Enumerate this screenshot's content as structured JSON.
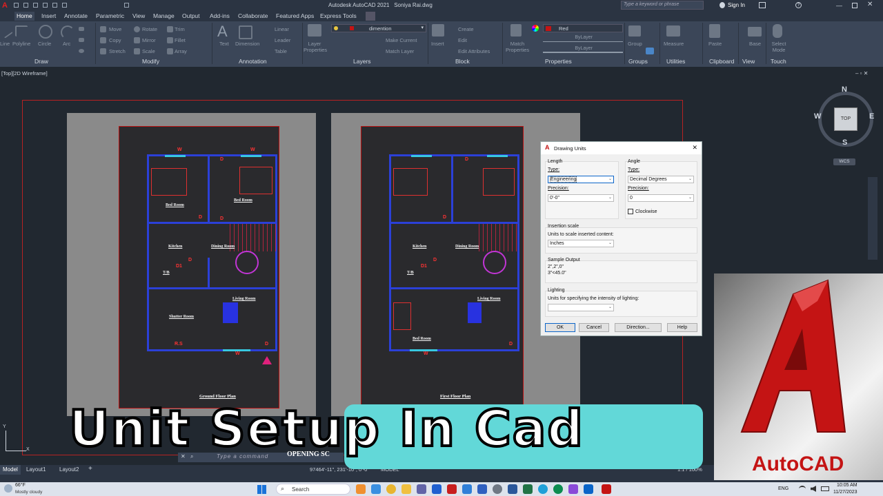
{
  "title_bar": {
    "app_title": "Autodesk AutoCAD 2021",
    "file_name": "Soniya Rai.dwg",
    "search_placeholder": "Type a keyword or phrase",
    "sign_in": "Sign In"
  },
  "ribbon_tabs": [
    "Home",
    "Insert",
    "Annotate",
    "Parametric",
    "View",
    "Manage",
    "Output",
    "Add-ins",
    "Collaborate",
    "Featured Apps",
    "Express Tools"
  ],
  "ribbon": {
    "draw": {
      "label": "Draw",
      "items": [
        "Line",
        "Polyline",
        "Circle",
        "Arc"
      ]
    },
    "modify": {
      "label": "Modify",
      "items": [
        "Move",
        "Rotate",
        "Trim",
        "Mirror",
        "Fillet",
        "Copy",
        "Stretch",
        "Scale",
        "Array"
      ]
    },
    "annotation": {
      "label": "Annotation",
      "items": [
        "Text",
        "Dimension",
        "Linear",
        "Leader",
        "Table"
      ]
    },
    "layers": {
      "label": "Layers",
      "layer_properties": "Layer Properties",
      "current_layer": "dimention",
      "make_current": "Make Current",
      "match_layer": "Match Layer"
    },
    "block": {
      "label": "Block",
      "insert": "Insert",
      "create": "Create",
      "edit": "Edit",
      "edit_attributes": "Edit Attributes"
    },
    "properties": {
      "label": "Properties",
      "match": "Match Properties",
      "color": "Red",
      "bylayer_1": "ByLayer",
      "bylayer_2": "ByLayer"
    },
    "groups": {
      "label": "Groups",
      "group": "Group"
    },
    "utilities": {
      "label": "Utilities",
      "measure": "Measure"
    },
    "clipboard": {
      "label": "Clipboard",
      "paste": "Paste"
    },
    "view": {
      "label": "View",
      "base": "Base"
    },
    "touch": {
      "label": "Touch",
      "select_mode": "Select Mode"
    }
  },
  "viewport": {
    "label": "[Top][2D Wireframe]",
    "viewcube": {
      "n": "N",
      "s": "S",
      "e": "E",
      "w": "W",
      "top": "TOP",
      "wcs": "WCS"
    },
    "ucs": {
      "y": "Y",
      "x": "X"
    }
  },
  "plans": [
    {
      "title": "Ground Floor Plan",
      "rooms": [
        {
          "name": "Bed Room",
          "dims": "11'-10\" x 11'-10\""
        },
        {
          "name": "Bed Room",
          "dims": "11'-10\" x 11'-10\""
        },
        {
          "name": "Kitchen",
          "dims": "7'-10\" x 8'-6\""
        },
        {
          "name": "Dining Room",
          "dims": "11'-3\" x 7'-6\""
        },
        {
          "name": "T/B",
          "dims": "5'-6\" x 8'-6\""
        },
        {
          "name": "Living Room",
          "dims": "11'-10\" x 11'-5\""
        },
        {
          "name": "Shutter Room",
          "dims": "11'-3\" x 11'-5\""
        }
      ],
      "marks": [
        "W",
        "W",
        "D",
        "D",
        "D",
        "D",
        "D1",
        "R.S",
        "D",
        "W"
      ]
    },
    {
      "title": "First Floor Plan",
      "rooms": [
        {
          "name": "Kitchen",
          "dims": "7'-10\" x 8'-6\""
        },
        {
          "name": "Dining Room",
          "dims": "11'-3\" x 7'-6\""
        },
        {
          "name": "T/B",
          "dims": "5'-6\" x 8'-6\""
        },
        {
          "name": "Living Room",
          "dims": "11'-10\" x 11'-5\""
        },
        {
          "name": "Bed Room",
          "dims": "11'-3\" x 11'-5\""
        }
      ],
      "marks": [
        "D",
        "D",
        "D",
        "D1",
        "D",
        "W"
      ]
    }
  ],
  "dialog": {
    "title": "Drawing Units",
    "length": {
      "group": "Length",
      "type_label": "Type:",
      "type_value": "Engineering",
      "precision_label": "Precision:",
      "precision_value": "0'-0\""
    },
    "angle": {
      "group": "Angle",
      "type_label": "Type:",
      "type_value": "Decimal Degrees",
      "precision_label": "Precision:",
      "precision_value": "0",
      "clockwise": "Clockwise"
    },
    "insertion": {
      "group": "Insertion scale",
      "label": "Units to scale inserted content:",
      "value": "Inches"
    },
    "sample": {
      "group": "Sample Output",
      "line1": "2\",2\",0\"",
      "line2": "3\"<45.0\""
    },
    "lighting": {
      "group": "Lighting",
      "label": "Units for specifying the intensity of lighting:",
      "value": ""
    },
    "buttons": {
      "ok": "OK",
      "cancel": "Cancel",
      "direction": "Direction...",
      "help": "Help"
    }
  },
  "command_line": {
    "placeholder": "Type a command",
    "behind_text": "OPENING SC"
  },
  "layout_tabs": [
    "Model",
    "Layout1",
    "Layout2"
  ],
  "status_bar": {
    "coords": "97464'-11\", 231'-10\", 0'-0\"",
    "model": "MODEL",
    "scale": "1:1 / 100%"
  },
  "banner": {
    "text": "Unit Setup In Cad"
  },
  "logo": {
    "text": "AutoCAD"
  },
  "taskbar": {
    "temp": "66°F",
    "weather": "Mostly cloudy",
    "search": "Search",
    "lang": "ENG",
    "time": "10:05 AM",
    "date": "11/27/2023"
  },
  "colors": {
    "accent_red": "#c41414",
    "banner_teal": "#62d8d8",
    "bg_dark": "#212830",
    "ribbon": "#3b4658"
  }
}
